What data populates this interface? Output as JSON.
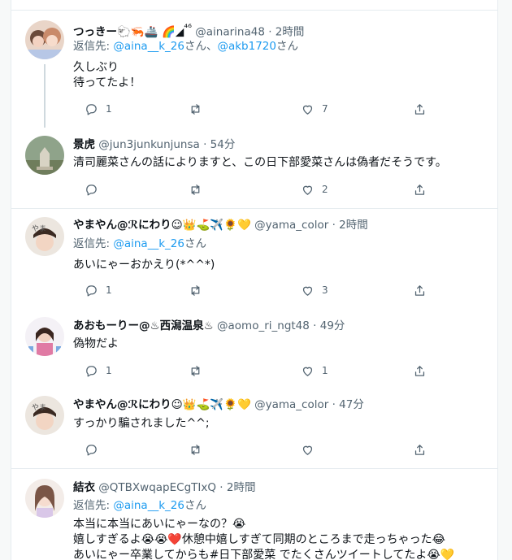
{
  "tweets": [
    {
      "name": "つっきー🐑🦐🚢 🌈◢",
      "badge": "⁴⁶",
      "handle": "@ainarina48",
      "time": "2時間",
      "reply_prefix": "返信先: ",
      "reply_mentions": [
        "@aina__k_26",
        "@akb1720"
      ],
      "reply_suffix": "さん",
      "reply_between": "さん、",
      "text": "久しぶり\n待ってたよ！",
      "replies": "1",
      "retweets": "",
      "likes": "7"
    },
    {
      "name": "景虎",
      "handle": "@jun3junkunjunsa",
      "time": "54分",
      "text": "清司麗菜さんの話によりますと、この日下部愛菜さんは偽者だそうです。",
      "replies": "",
      "retweets": "",
      "likes": "2"
    },
    {
      "name": "やまやん@ℛにわり☺👑⛳✈️🌻💛",
      "handle": "@yama_color",
      "time": "2時間",
      "reply_prefix": "返信先: ",
      "reply_mentions": [
        "@aina__k_26"
      ],
      "reply_suffix": "さん",
      "text": "あいにゃーおかえり(*^^*)",
      "replies": "1",
      "retweets": "",
      "likes": "3"
    },
    {
      "name": "あおもーりー@♨西潟温泉♨",
      "handle": "@aomo_ri_ngt48",
      "time": "49分",
      "text": "偽物だよ",
      "replies": "1",
      "retweets": "",
      "likes": "1"
    },
    {
      "name": "やまやん@ℛにわり☺👑⛳✈️🌻💛",
      "handle": "@yama_color",
      "time": "47分",
      "text": "すっかり騙されました^^;",
      "replies": "",
      "retweets": "",
      "likes": ""
    },
    {
      "name": "結衣",
      "handle": "@QTBXwqapECgTIxQ",
      "time": "2時間",
      "reply_prefix": "返信先: ",
      "reply_mentions": [
        "@aina__k_26"
      ],
      "reply_suffix": "さん",
      "text": "本当に本当にあいにゃーなの？😭\n嬉しすぎるよ😭😭❤️休憩中嬉しすぎて同期のところまで走っちゃった😂\nあいにゃー卒業してからも#日下部愛菜 でたくさんツイートしてたよ😭💛",
      "replies": "",
      "retweets": "",
      "likes": ""
    }
  ],
  "separator": " · ",
  "colors": {
    "accent": "#1d9bf0",
    "muted": "#536471",
    "border": "#e6ecf0",
    "page_bg": "#f7f9f9"
  },
  "icons": [
    "reply-icon",
    "retweet-icon",
    "like-icon",
    "share-icon"
  ]
}
